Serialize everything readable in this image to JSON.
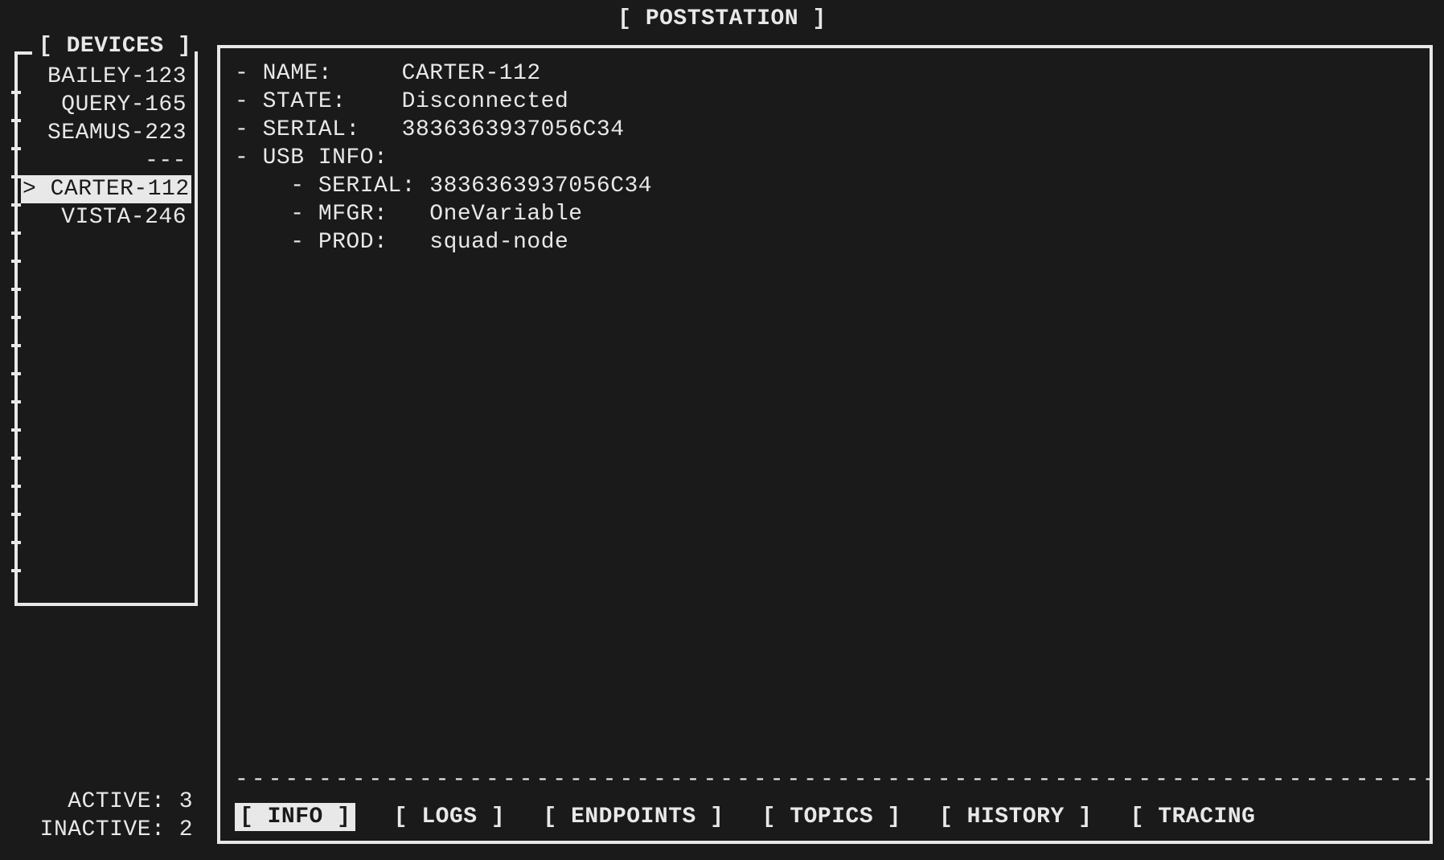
{
  "app": {
    "title": "[ POSTSTATION ]"
  },
  "sidebar": {
    "title": "[ DEVICES ]",
    "items": [
      {
        "label": "BAILEY-123",
        "selected": false
      },
      {
        "label": "QUERY-165",
        "selected": false
      },
      {
        "label": "SEAMUS-223",
        "selected": false
      },
      {
        "label": "---",
        "selected": false
      },
      {
        "label": "CARTER-112",
        "selected": true
      },
      {
        "label": "VISTA-246",
        "selected": false
      }
    ]
  },
  "status": {
    "active_label": "ACTIVE:",
    "active_count": "3",
    "inactive_label": "INACTIVE:",
    "inactive_count": "2"
  },
  "detail": {
    "name_label": "- NAME:",
    "name_value": "CARTER-112",
    "state_label": "- STATE:",
    "state_value": "Disconnected",
    "serial_label": "- SERIAL:",
    "serial_value": "3836363937056C34",
    "usb_header": "- USB INFO:",
    "usb_serial_label": "- SERIAL:",
    "usb_serial_value": "3836363937056C34",
    "usb_mfgr_label": "- MFGR:",
    "usb_mfgr_value": "OneVariable",
    "usb_prod_label": "- PROD:",
    "usb_prod_value": "squad-node"
  },
  "tabs": {
    "info": "[ INFO ]",
    "logs": "[ LOGS ]",
    "endpoints": "[ ENDPOINTS ]",
    "topics": "[ TOPICS ]",
    "history": "[ HISTORY ]",
    "tracing": "[ TRACING"
  }
}
